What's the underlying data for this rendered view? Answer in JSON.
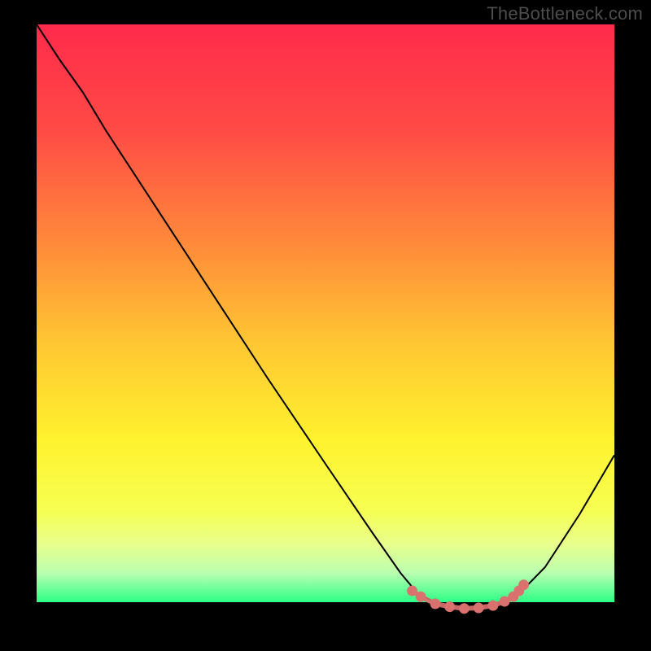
{
  "watermark": "TheBottleneck.com",
  "chart_data": {
    "type": "line",
    "title": "",
    "xlabel": "",
    "ylabel": "",
    "xlim": [
      0,
      100
    ],
    "ylim": [
      0,
      100
    ],
    "gradient_stops": [
      {
        "offset": 0.0,
        "color": "#ff2a4b"
      },
      {
        "offset": 0.18,
        "color": "#ff4a46"
      },
      {
        "offset": 0.38,
        "color": "#ff8a3a"
      },
      {
        "offset": 0.55,
        "color": "#ffc633"
      },
      {
        "offset": 0.72,
        "color": "#fff22e"
      },
      {
        "offset": 0.84,
        "color": "#f6ff52"
      },
      {
        "offset": 0.9,
        "color": "#e8ff8c"
      },
      {
        "offset": 0.95,
        "color": "#b9ffb1"
      },
      {
        "offset": 1.0,
        "color": "#2cff86"
      }
    ],
    "series": [
      {
        "name": "bottleneck-curve",
        "color": "#000000",
        "width": 2,
        "points": [
          {
            "x": 0.0,
            "y": 100.0
          },
          {
            "x": 4.0,
            "y": 94.0
          },
          {
            "x": 8.0,
            "y": 88.5
          },
          {
            "x": 12.0,
            "y": 82.0
          },
          {
            "x": 20.0,
            "y": 70.0
          },
          {
            "x": 30.0,
            "y": 55.0
          },
          {
            "x": 40.0,
            "y": 40.0
          },
          {
            "x": 50.0,
            "y": 25.5
          },
          {
            "x": 58.0,
            "y": 14.0
          },
          {
            "x": 63.0,
            "y": 7.0
          },
          {
            "x": 66.0,
            "y": 3.5
          },
          {
            "x": 70.0,
            "y": 1.5
          },
          {
            "x": 75.0,
            "y": 1.0
          },
          {
            "x": 80.0,
            "y": 1.5
          },
          {
            "x": 83.0,
            "y": 3.0
          },
          {
            "x": 88.0,
            "y": 8.0
          },
          {
            "x": 94.0,
            "y": 17.0
          },
          {
            "x": 100.0,
            "y": 27.0
          }
        ]
      },
      {
        "name": "flat-region-markers",
        "color": "#d9716e",
        "type": "scatter-line",
        "marker_radius": 5,
        "points": [
          {
            "x": 65.0,
            "y": 4.0
          },
          {
            "x": 66.5,
            "y": 3.0
          },
          {
            "x": 69.0,
            "y": 1.8
          },
          {
            "x": 71.5,
            "y": 1.3
          },
          {
            "x": 74.0,
            "y": 1.0
          },
          {
            "x": 76.5,
            "y": 1.1
          },
          {
            "x": 79.0,
            "y": 1.5
          },
          {
            "x": 81.0,
            "y": 2.2
          },
          {
            "x": 82.5,
            "y": 3.0
          },
          {
            "x": 83.5,
            "y": 4.0
          },
          {
            "x": 84.3,
            "y": 5.0
          }
        ]
      }
    ]
  }
}
